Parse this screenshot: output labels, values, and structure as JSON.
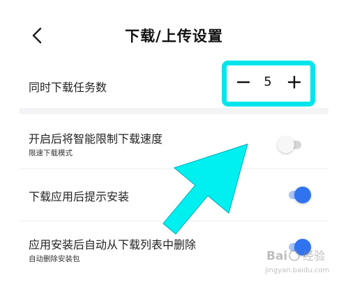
{
  "header": {
    "title": "下载/上传设置",
    "back_icon": "chevron-left-icon"
  },
  "settings": {
    "concurrent": {
      "label": "同时下载任务数",
      "value": "5",
      "minus_icon": "minus-icon",
      "plus_icon": "plus-icon"
    },
    "speed_limit": {
      "title": "开启后将智能限制下载速度",
      "subtitle": "限速下载模式",
      "enabled": false
    },
    "install_prompt": {
      "title": "下载应用后提示安装",
      "enabled": true
    },
    "auto_delete": {
      "title": "应用安装后自动从下载列表中删除",
      "subtitle": "自动删除安装包",
      "enabled": true
    }
  },
  "annotation": {
    "highlight_color": "#00e5ec",
    "arrow_color": "#00f0f0"
  },
  "colors": {
    "toggle_on": "#2f73f0",
    "toggle_on_track": "#a9c4f5",
    "toggle_off_track": "#d6d6d6"
  },
  "watermark": {
    "text": "Bai经验",
    "url": "jingyan.baidu.com"
  }
}
